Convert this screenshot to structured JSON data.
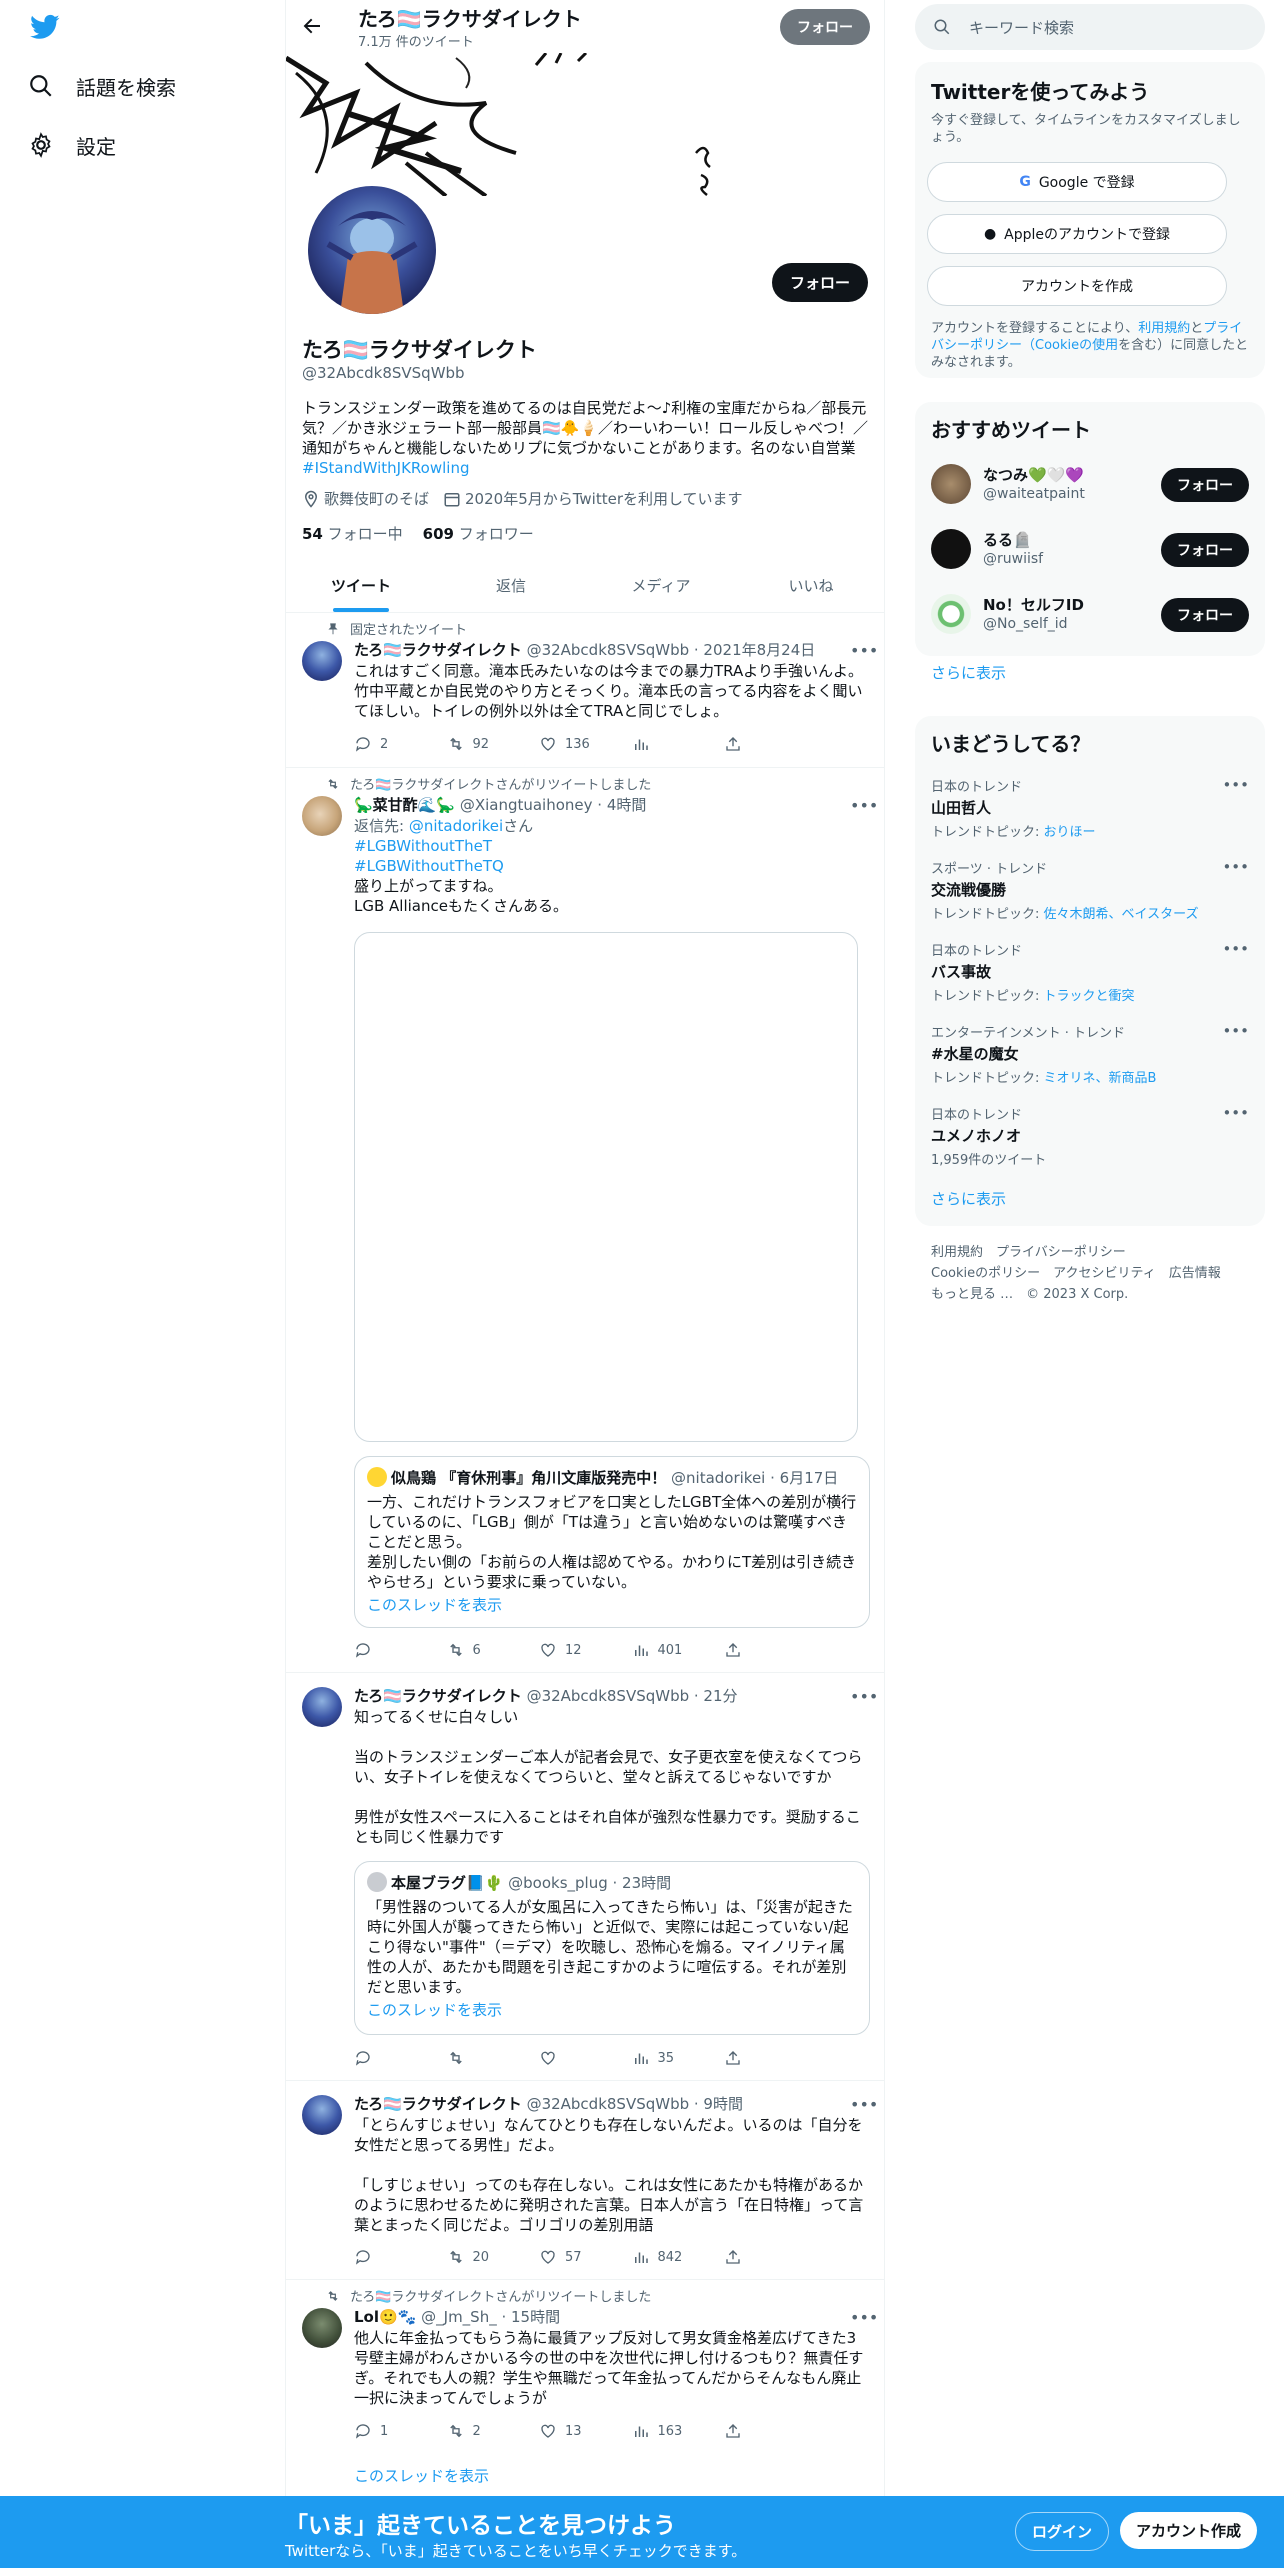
{
  "nav": {
    "explore": "話題を検索",
    "settings": "設定"
  },
  "header": {
    "name": "たろ🏳️‍⚧️ラクサダイレクト",
    "tweet_count": "7.1万 件のツイート",
    "follow": "フォロー"
  },
  "profile": {
    "name": "たろ🏳️‍⚧️ラクサダイレクト",
    "handle": "@32Abcdk8SVSqWbb",
    "follow": "フォロー",
    "bio": "トランスジェンダー政策を進めてるのは自民党だよ〜♪利権の宝庫だからね／部長元気？／かき氷ジェラート部一般部員🏳️‍⚧️🐥🍦／わーいわーい！ロール反しゃべつ！／通知がちゃんと機能しないためリプに気づかないことがあります。名のない自営業 ",
    "bio_tag": "#IStandWithJKRowling",
    "location": "歌舞伎町のそば",
    "joined": "2020年5月からTwitterを利用しています",
    "following_count": "54",
    "following_label": "フォロー中",
    "followers_count": "609",
    "followers_label": "フォロワー"
  },
  "tabs": [
    "ツイート",
    "返信",
    "メディア",
    "いいね"
  ],
  "tweets": [
    {
      "context": "固定されたツイート",
      "name": "たろ🏳️‍⚧️ラクサダイレクト",
      "meta": "@32Abcdk8SVSqWbb · 2021年8月24日",
      "body": "これはすごく同意。滝本氏みたいなのは今までの暴力TRAより手強いんよ。竹中平蔵とか自民党のやり方とそっくり。滝本氏の言ってる内容をよく聞いてほしい。トイレの例外以外は全てTRAと同じでしょ。",
      "reply": "2",
      "retweet": "92",
      "like": "136"
    },
    {
      "context": "たろ🏳️‍⚧️ラクサダイレクトさんがリツイートしました",
      "name": "🦕菜甘酢🌊🦕",
      "meta": "@Xiangtuaihoney · 4時間",
      "reply_to_label": "返信先: ",
      "reply_to": "@nitadorikei",
      "reply_suffix": "さん",
      "tag1": "#LGBWithoutTheT",
      "tag2": "#LGBWithoutTheTQ",
      "body": "盛り上がってますね。\nLGB Allianceもたくさんある。",
      "quote_name": "似鳥鶏 『育休刑事』角川文庫版発売中！",
      "quote_meta": "@nitadorikei · 6月17日",
      "quote_body": "一方、これだけトランスフォビアを口実としたLGBT全体への差別が横行しているのに、「LGB」側が「Tは違う」と言い始めないのは驚嘆すべきことだと思う。\n差別したい側の「お前らの人権は認めてやる。かわりにT差別は引き続きやらせろ」という要求に乗っていない。",
      "quote_link": "このスレッドを表示",
      "retweet": "6",
      "like": "12",
      "views": "401"
    },
    {
      "name": "たろ🏳️‍⚧️ラクサダイレクト",
      "meta": "@32Abcdk8SVSqWbb · 21分",
      "body": "知ってるくせに白々しい\n\n当のトランスジェンダーご本人が記者会見で、女子更衣室を使えなくてつらい、女子トイレを使えなくてつらいと、堂々と訴えてるじゃないですか\n\n男性が女性スペースに入ることはそれ自体が強烈な性暴力です。奨励することも同じく性暴力です",
      "quote_name": "本屋ブラグ📘🌵",
      "quote_meta": "@books_plug · 23時間",
      "quote_body": "「男性器のついてる人が女風呂に入ってきたら怖い」は、「災害が起きた時に外国人が襲ってきたら怖い」と近似で、実際には起こっていない/起こり得ない\"事件\"（＝デマ）を吹聴し、恐怖心を煽る。マイノリティ属性の人が、あたかも問題を引き起こすかのように喧伝する。それが差別だと思います。",
      "quote_link": "このスレッドを表示",
      "views": "35"
    },
    {
      "name": "たろ🏳️‍⚧️ラクサダイレクト",
      "meta": "@32Abcdk8SVSqWbb · 9時間",
      "body": "「とらんすじょせい」なんてひとりも存在しないんだよ。いるのは「自分を女性だと思ってる男性」だよ。\n\n「しすじょせい」ってのも存在しない。これは女性にあたかも特権があるかのように思わせるために発明された言葉。日本人が言う「在日特権」って言葉とまったく同じだよ。ゴリゴリの差別用語",
      "retweet": "20",
      "like": "57",
      "views": "842"
    },
    {
      "context": "たろ🏳️‍⚧️ラクサダイレクトさんがリツイートしました",
      "name": "Lol🙂🐾",
      "meta": "@_Jm_Sh_ · 15時間",
      "body": "他人に年金払ってもらう為に最賃アップ反対して男女賃金格差広げてきた3号壁主婦がわんさかいる今の世の中を次世代に押し付けるつもり？無責任すぎ。それでも人の親？学生や無職だって年金払ってんだからそんなもん廃止一択に決まってんでしょうが",
      "reply": "1",
      "retweet": "2",
      "like": "13",
      "views": "163",
      "thread_link": "このスレッドを表示"
    }
  ],
  "search": {
    "placeholder": "キーワード検索"
  },
  "signup_card": {
    "title": "Twitterを使ってみよう",
    "subtitle": "今すぐ登録して、タイムラインをカスタマイズしましょう。",
    "google": "Google で登録",
    "apple": "Appleのアカウントで登録",
    "create": "アカウントを作成",
    "terms_prefix": "アカウントを登録することにより、",
    "terms": "利用規約",
    "and": "と",
    "privacy": "プライバシーポリシー（Cookieの使用",
    "terms_suffix": "を含む）に同意したとみなされます。"
  },
  "recommend": {
    "title": "おすすめツイート",
    "users": [
      {
        "name": "なつみ💚🤍💜",
        "handle": "@waiteatpaint",
        "follow": "フォロー"
      },
      {
        "name": "るる🪦",
        "handle": "@ruwiisf",
        "follow": "フォロー"
      },
      {
        "name": "No！セルフID",
        "handle": "@No_self_id",
        "follow": "フォロー"
      }
    ],
    "more": "さらに表示"
  },
  "trends": {
    "title": "いまどうしてる？",
    "items": [
      {
        "cat": "日本のトレンド",
        "title": "山田哲人",
        "sub_label": "トレンドトピック: ",
        "sub": "おりほー"
      },
      {
        "cat": "スポーツ · トレンド",
        "title": "交流戦優勝",
        "sub_label": "トレンドトピック: ",
        "sub": "佐々木朗希、ベイスターズ"
      },
      {
        "cat": "日本のトレンド",
        "title": "バス事故",
        "sub_label": "トレンドトピック: ",
        "sub": "トラックと衝突"
      },
      {
        "cat": "エンターテインメント · トレンド",
        "title": "#水星の魔女",
        "sub_label": "トレンドトピック: ",
        "sub": "ミオリネ、新商品B"
      },
      {
        "cat": "日本のトレンド",
        "title": "ユメノホノオ",
        "sub_label": "",
        "sub": "1,959件のツイート"
      }
    ],
    "more": "さらに表示"
  },
  "footer": {
    "l1": "利用規約　プライバシーポリシー",
    "l2": "Cookieのポリシー　アクセシビリティ　広告情報",
    "l3": "もっと見る …　© 2023 X Corp."
  },
  "bottom": {
    "title": "「いま」起きていることを見つけよう",
    "subtitle": "Twitterなら、「いま」起きていることをいち早くチェックできます。",
    "login": "ログイン",
    "signup": "アカウント作成"
  },
  "colors": {
    "accent": "#1d9bf0",
    "text": "#0f1419",
    "muted": "#536471"
  }
}
